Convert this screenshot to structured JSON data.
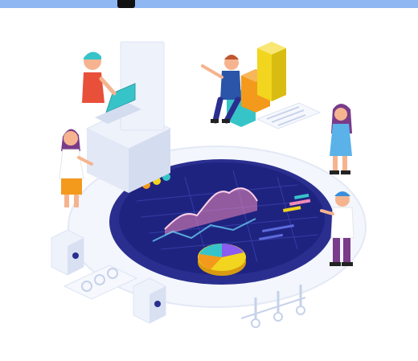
{
  "image": {
    "kind": "isometric data-analytics illustration",
    "has_text": false
  },
  "colors": {
    "top_bar": "#8fb8f2",
    "disk": "#2a2f8f",
    "disk_inner": "#1f2380",
    "accent_orange": "#f39a1c",
    "accent_yellow": "#f2d51e",
    "accent_teal": "#37c4c9",
    "accent_pink": "#f08bb9",
    "person_red": "#e8503a"
  },
  "icons": [
    "laptop-icon",
    "bar-chart-icon",
    "pie-chart-icon",
    "server-icon",
    "network-nodes-icon"
  ]
}
